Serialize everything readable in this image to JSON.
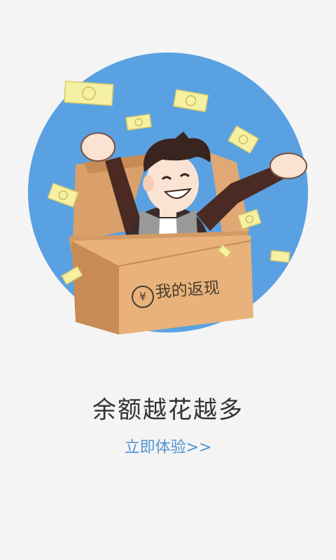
{
  "onboarding": {
    "box_label": "我的返现",
    "box_currency_symbol": "¥",
    "headline": "余额越花越多",
    "cta_label": "立即体验>>"
  },
  "colors": {
    "background": "#f4f4f4",
    "circle": "#5aa1e2",
    "box": "#e8b27a",
    "box_shade": "#c98b55",
    "banknote": "#f6f0a2",
    "headline": "#333333",
    "cta": "#4f93d2"
  },
  "icons": {
    "currency": "yen-icon",
    "banknote": "banknote-icon",
    "hero": "happy-man-illustration"
  }
}
